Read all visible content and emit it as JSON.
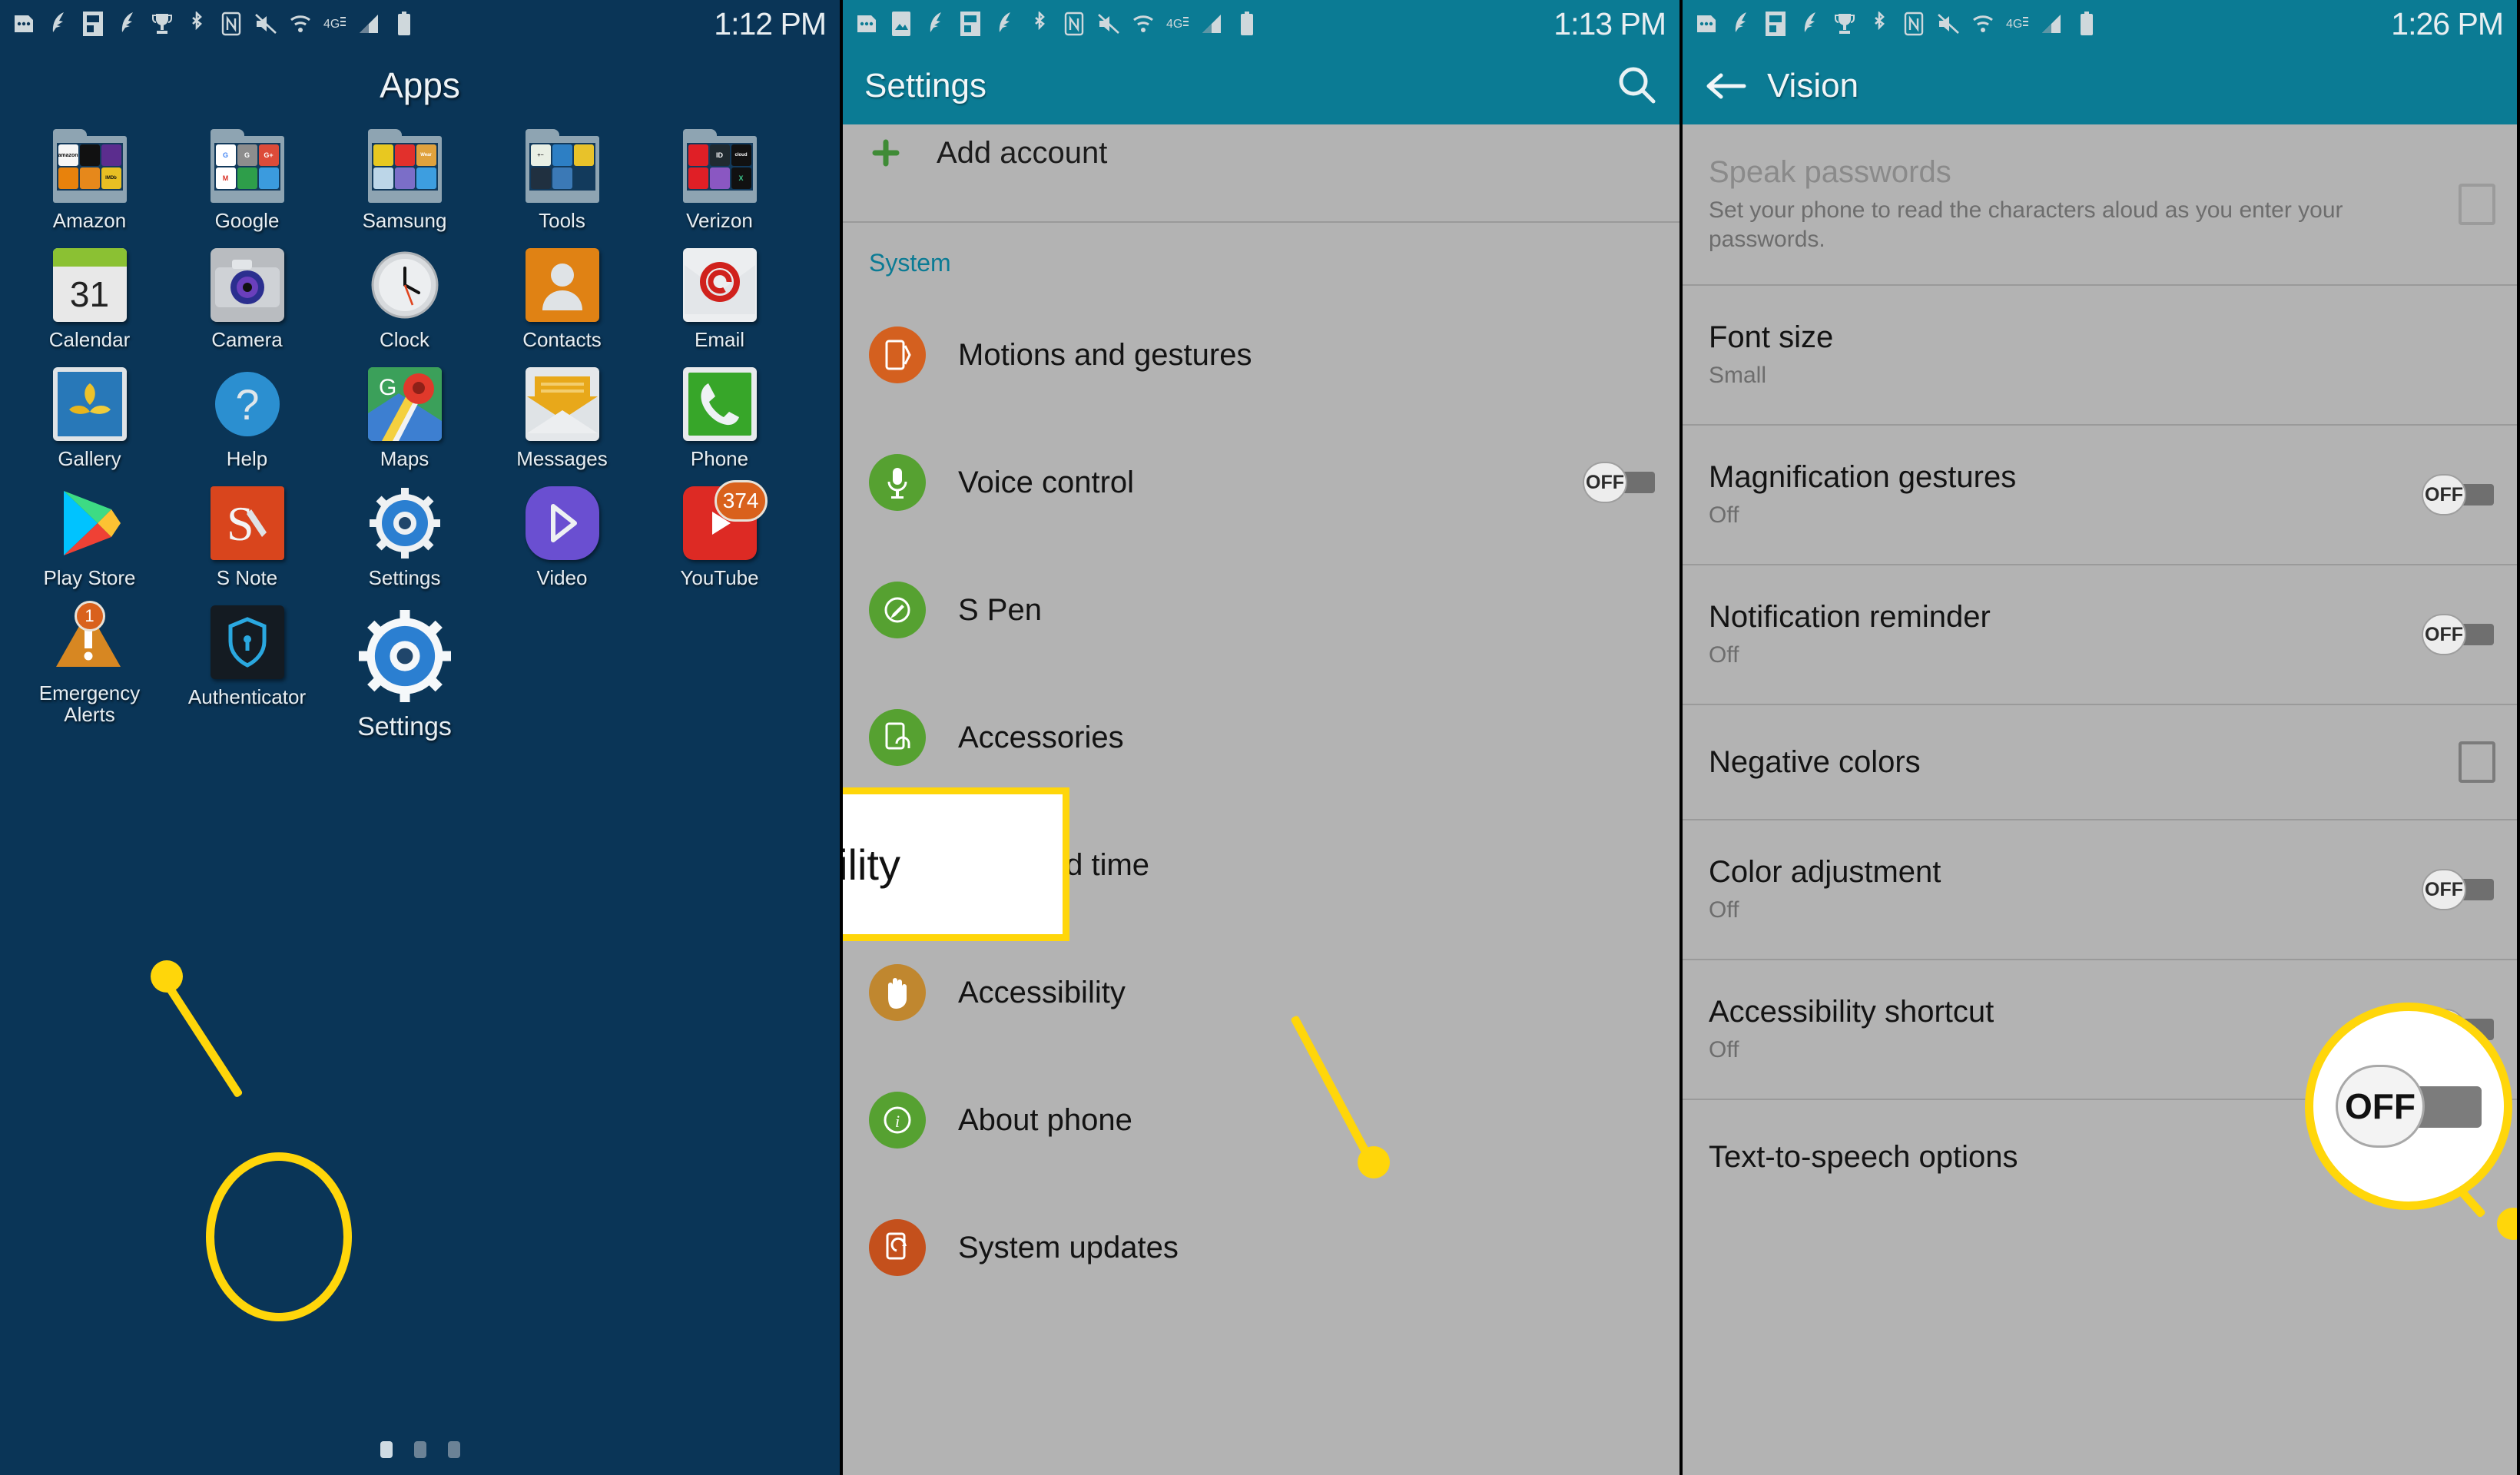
{
  "panels": {
    "apps": {
      "statusbar": {
        "icons": [
          "sim-dots-icon",
          "feather-icon",
          "flipboard-icon",
          "feather-icon",
          "trophy-icon",
          "bluetooth-icon",
          "nfc-icon",
          "mute-icon",
          "wifi-icon",
          "4g-lte-icon",
          "signal-icon",
          "battery-icon"
        ],
        "time": "1:12 PM"
      },
      "title": "Apps",
      "rows": [
        [
          {
            "label": "Amazon",
            "type": "folder"
          },
          {
            "label": "Google",
            "type": "folder"
          },
          {
            "label": "Samsung",
            "type": "folder"
          },
          {
            "label": "Tools",
            "type": "folder"
          },
          {
            "label": "Verizon",
            "type": "folder"
          }
        ],
        [
          {
            "label": "Calendar",
            "type": "app",
            "day": "31"
          },
          {
            "label": "Camera",
            "type": "app"
          },
          {
            "label": "Clock",
            "type": "app"
          },
          {
            "label": "Contacts",
            "type": "app"
          },
          {
            "label": "Email",
            "type": "app"
          }
        ],
        [
          {
            "label": "Gallery",
            "type": "app"
          },
          {
            "label": "Help",
            "type": "app"
          },
          {
            "label": "Maps",
            "type": "app"
          },
          {
            "label": "Messages",
            "type": "app"
          },
          {
            "label": "Phone",
            "type": "app"
          }
        ],
        [
          {
            "label": "Play Store",
            "type": "app"
          },
          {
            "label": "S Note",
            "type": "app"
          },
          {
            "label": "Settings",
            "type": "app"
          },
          {
            "label": "Video",
            "type": "app"
          },
          {
            "label": "YouTube",
            "type": "app",
            "badge": "374"
          }
        ],
        [
          {
            "label": "Emergency Alerts",
            "type": "app",
            "badge": "1"
          },
          {
            "label": "Authenticator",
            "type": "app"
          },
          {
            "label": "Settings",
            "type": "app",
            "highlighted": true
          }
        ]
      ],
      "page_dots": {
        "count": 3,
        "active_index": 0
      }
    },
    "settings": {
      "statusbar": {
        "time": "1:13 PM"
      },
      "header": {
        "title": "Settings",
        "search_icon": "search-icon"
      },
      "scrolled_item": "Add account",
      "section_label": "System",
      "items": [
        {
          "label": "Motions and gestures",
          "icon": "motions-icon",
          "icon_color": "#d4601f",
          "toggle": null
        },
        {
          "label": "Voice control",
          "icon": "microphone-icon",
          "icon_color": "#56a131",
          "toggle": "OFF"
        },
        {
          "label": "S Pen",
          "icon": "spen-icon",
          "icon_color": "#56a131",
          "toggle": null
        },
        {
          "label": "Accessories",
          "icon": "accessories-icon",
          "icon_color": "#56a131",
          "toggle": null
        },
        {
          "label": "Date and time",
          "icon": "calendar-clock-icon",
          "icon_color": "#56a131",
          "toggle": null
        },
        {
          "label": "Accessibility",
          "icon": "hand-icon",
          "icon_color": "#c0872f",
          "toggle": null
        },
        {
          "label": "About phone",
          "icon": "info-icon",
          "icon_color": "#56a131",
          "toggle": null
        },
        {
          "label": "System updates",
          "icon": "system-update-icon",
          "icon_color": "#c4501c",
          "toggle": null
        }
      ],
      "callout": {
        "label": "Accessibility",
        "icon": "hand-icon"
      }
    },
    "vision": {
      "statusbar": {
        "time": "1:26 PM"
      },
      "header": {
        "title": "Vision",
        "back_icon": "arrow-left-icon"
      },
      "items": [
        {
          "title": "Speak passwords",
          "subtitle": "Set your phone to read the characters aloud as you enter your passwords.",
          "control": "checkbox",
          "dim": true
        },
        {
          "title": "Font size",
          "subtitle": "Small",
          "control": "none",
          "dim": false
        },
        {
          "title": "Magnification gestures",
          "subtitle": "Off",
          "control": "toggle",
          "toggle_label": "OFF",
          "dim": false
        },
        {
          "title": "Notification reminder",
          "subtitle": "Off",
          "control": "toggle",
          "toggle_label": "OFF",
          "dim": false
        },
        {
          "title": "Negative colors",
          "subtitle": "",
          "control": "checkbox",
          "dim": false
        },
        {
          "title": "Color adjustment",
          "subtitle": "Off",
          "control": "toggle",
          "toggle_label": "OFF",
          "dim": false
        },
        {
          "title": "Accessibility shortcut",
          "subtitle": "Off",
          "control": "toggle",
          "toggle_label": "OFF",
          "dim": false
        },
        {
          "title": "Text-to-speech options",
          "subtitle": "",
          "control": "none",
          "dim": false
        }
      ],
      "callout": {
        "toggle_label": "OFF"
      }
    }
  },
  "colors": {
    "accent_highlight": "#ffd60a",
    "header_teal": "#0b7b94",
    "home_background": "#0a3557",
    "list_background": "#b3b3b3"
  }
}
